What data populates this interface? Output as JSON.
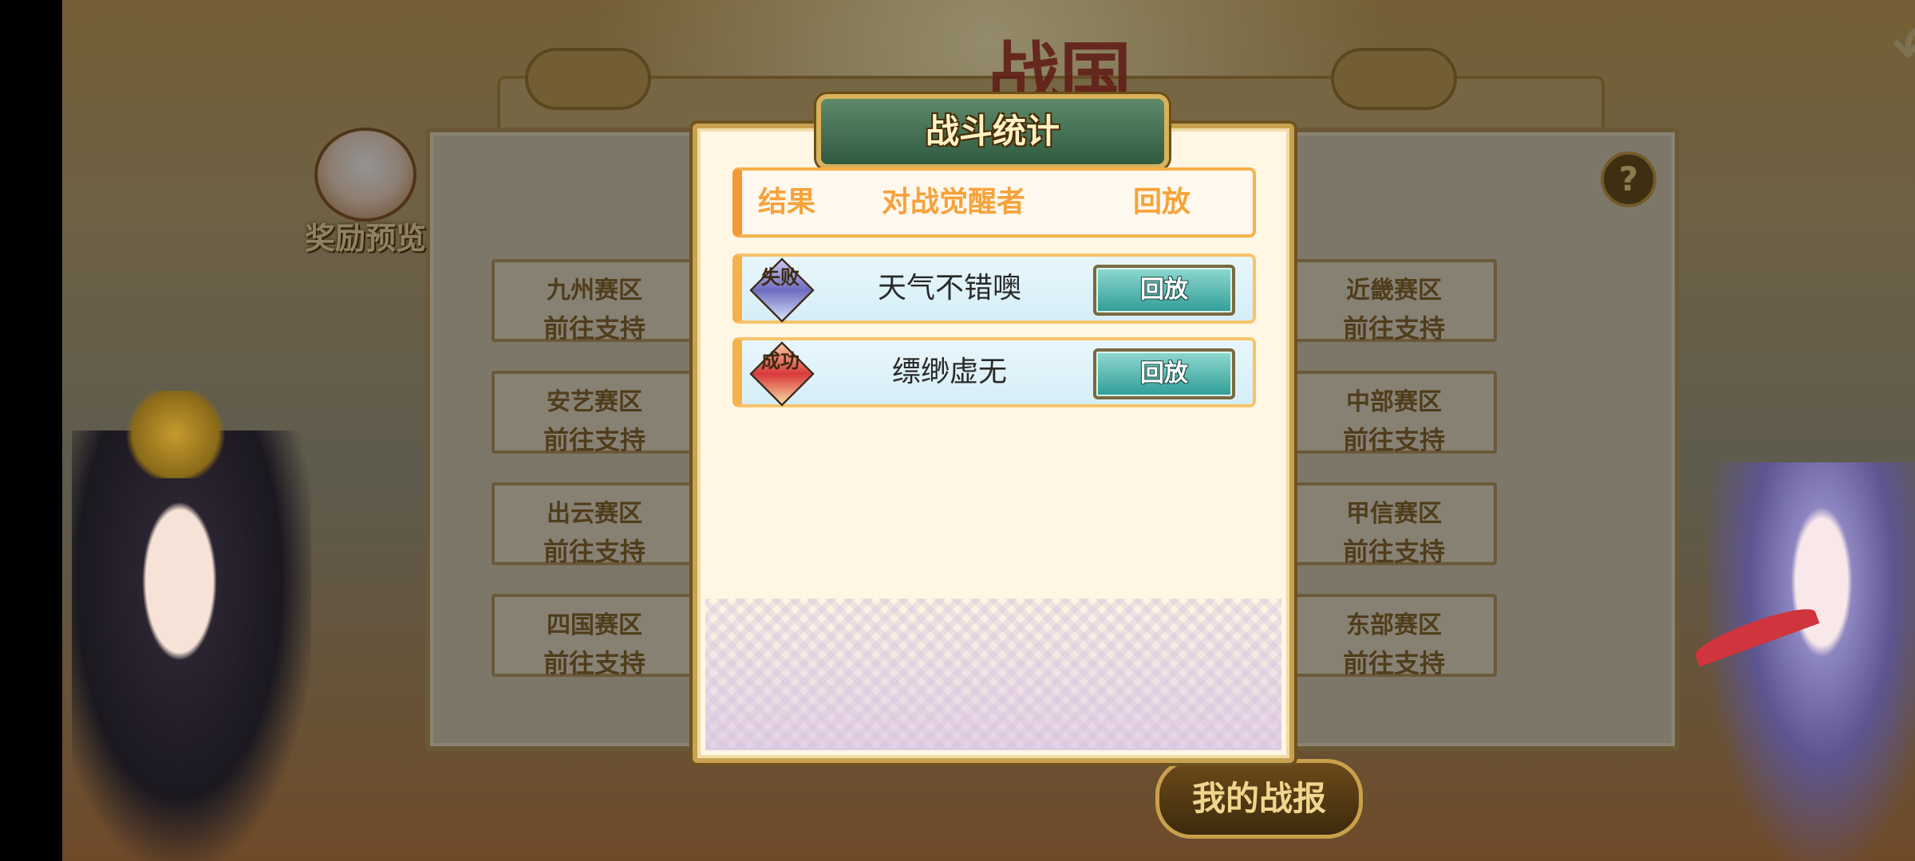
{
  "background": {
    "game_logo_text": "战国",
    "reward_preview_label": "奖励预览",
    "help_label": "?",
    "back_label": "↶",
    "my_battle_report_label": "我的战报",
    "regions_left": [
      {
        "name": "九州赛区",
        "action": "前往支持"
      },
      {
        "name": "安艺赛区",
        "action": "前往支持"
      },
      {
        "name": "出云赛区",
        "action": "前往支持"
      },
      {
        "name": "四国赛区",
        "action": "前往支持"
      }
    ],
    "regions_right": [
      {
        "name": "近畿赛区",
        "action": "前往支持"
      },
      {
        "name": "中部赛区",
        "action": "前往支持"
      },
      {
        "name": "甲信赛区",
        "action": "前往支持"
      },
      {
        "name": "东部赛区",
        "action": "前往支持"
      }
    ]
  },
  "dialog": {
    "title": "战斗统计",
    "headers": {
      "result": "结果",
      "opponent": "对战觉醒者",
      "replay": "回放"
    },
    "rows": [
      {
        "result": "失败",
        "opponent": "天气不错噢",
        "replay_label": "回放"
      },
      {
        "result": "成功",
        "opponent": "缥缈虚无",
        "replay_label": "回放"
      }
    ]
  },
  "colors": {
    "header_text": "#f7a23a",
    "dialog_bg": "#fff6e3",
    "replay_button": "#2f9d96",
    "title_bg": "#2f5a40"
  }
}
